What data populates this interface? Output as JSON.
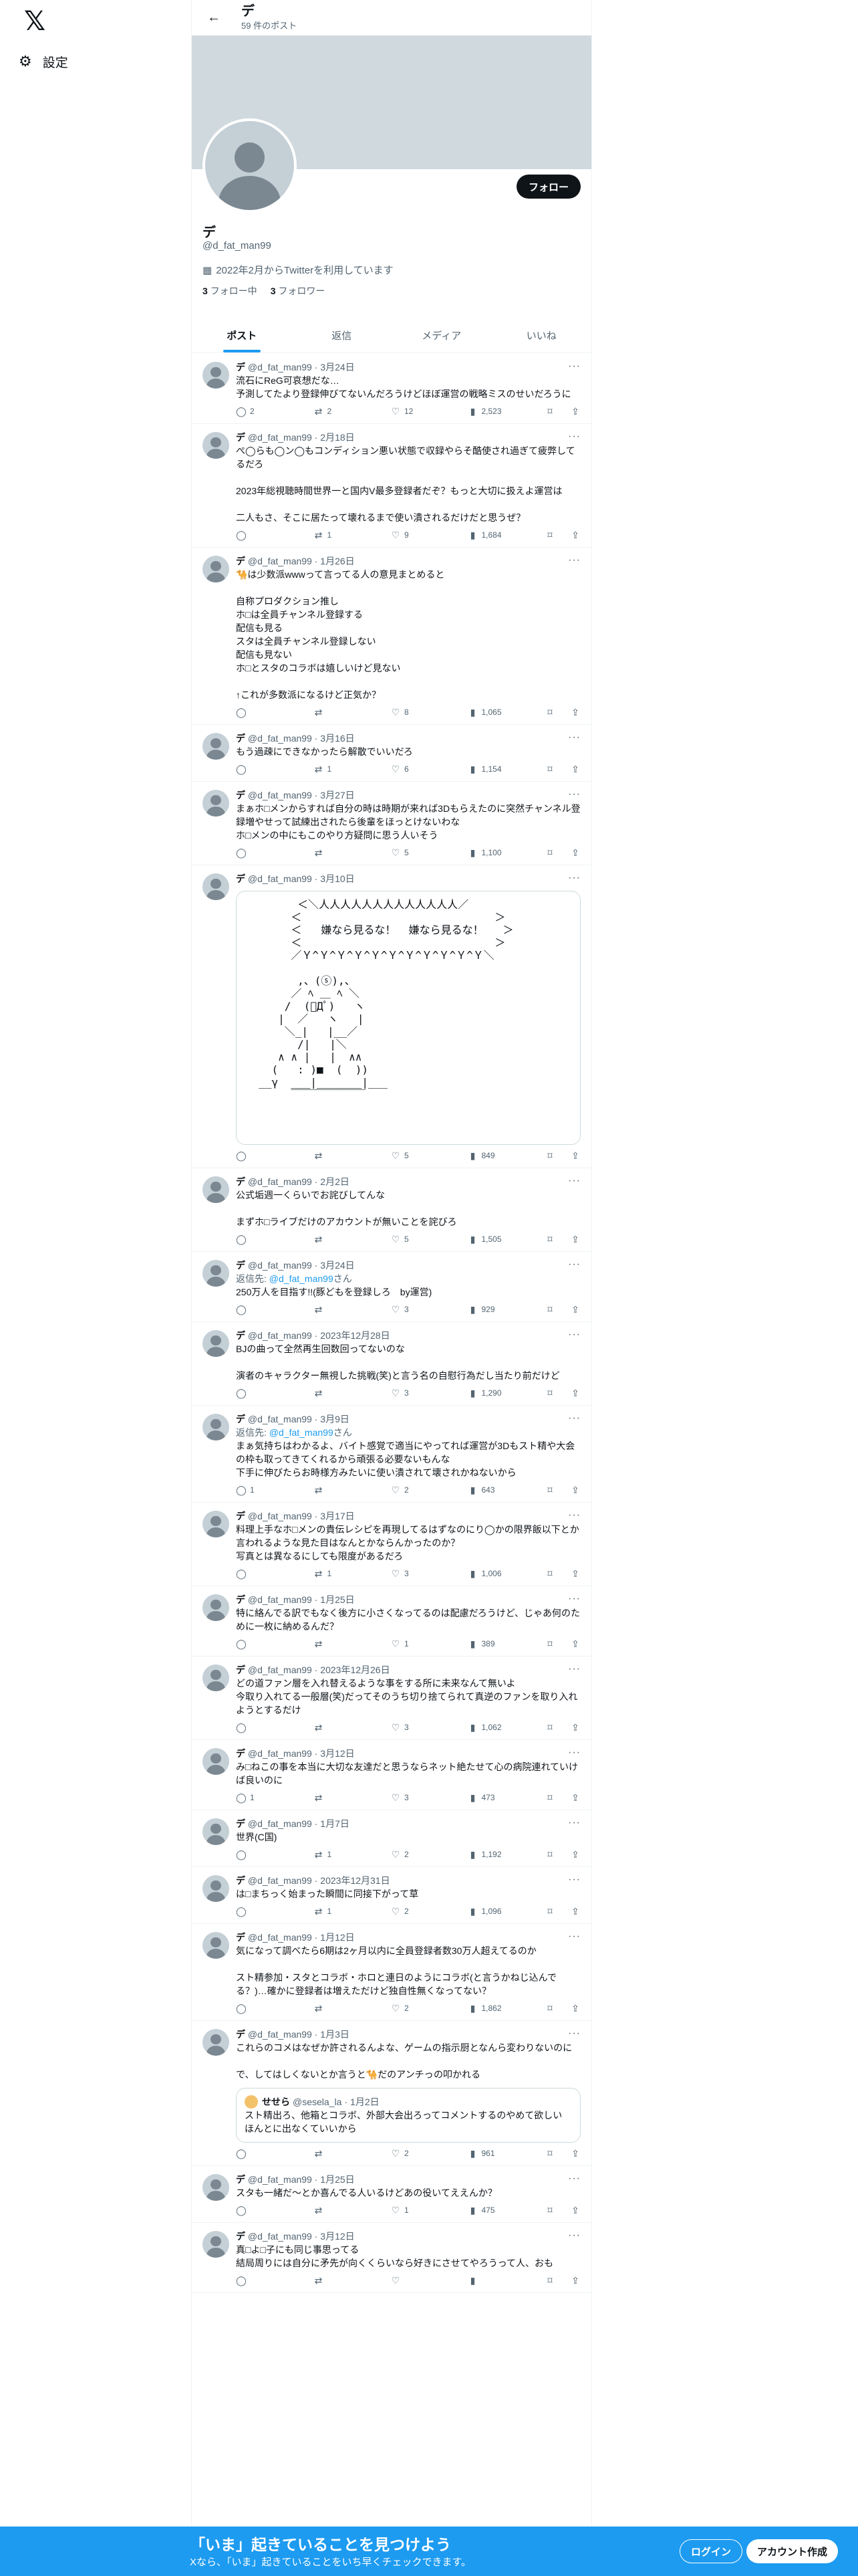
{
  "nav": {
    "logo": "𝕏",
    "settings_icon": "⚙",
    "settings_label": "設定"
  },
  "topbar": {
    "name": "デ",
    "post_count": "59 件のポスト",
    "back_icon": "←"
  },
  "profile": {
    "follow_label": "フォロー",
    "name": "デ",
    "handle": "@d_fat_man99",
    "joined": "2022年2月からTwitterを利用しています",
    "following_count": "3",
    "following_label": "フォロー中",
    "followers_count": "3",
    "followers_label": "フォロワー"
  },
  "tabs": [
    "ポスト",
    "返信",
    "メディア",
    "いいね"
  ],
  "tweets": [
    {
      "name": "デ",
      "handle": "@d_fat_man99",
      "date": "3月24日",
      "text": "流石にReG可哀想だな…\n予測してたより登録伸びてないんだろうけどほぼ運営の戦略ミスのせいだろうに",
      "reply": "2",
      "rt": "2",
      "like": "12",
      "views": "2,523"
    },
    {
      "name": "デ",
      "handle": "@d_fat_man99",
      "date": "2月18日",
      "text": "ぺ◯らも◯ン◯もコンディション悪い状態で収録やらそ酷使され過ぎて疲弊してるだろ\n\n2023年総視聴時間世界一と国内V最多登録者だぞ？もっと大切に扱えよ運営は\n\n二人もさ、そこに居たって壊れるまで使い潰されるだけだと思うぜ？",
      "reply": "",
      "rt": "1",
      "like": "9",
      "views": "1,684"
    },
    {
      "name": "デ",
      "handle": "@d_fat_man99",
      "date": "1月26日",
      "text": "🐪は少数派wwwって言ってる人の意見まとめると\n\n自称プロダクション推し\nホ□は全員チャンネル登録する\n配信も見る\nスタは全員チャンネル登録しない\n配信も見ない\nホ□とスタのコラボは嬉しいけど見ない\n\n↑これが多数派になるけど正気か？",
      "reply": "",
      "rt": "",
      "like": "8",
      "views": "1,065"
    },
    {
      "name": "デ",
      "handle": "@d_fat_man99",
      "date": "3月16日",
      "text": "もう過疎にできなかったら解散でいいだろ",
      "reply": "",
      "rt": "1",
      "like": "6",
      "views": "1,154"
    },
    {
      "name": "デ",
      "handle": "@d_fat_man99",
      "date": "3月27日",
      "text": "まぁホ□メンからすれば自分の時は時期が来れば3Dもらえたのに突然チャンネル登録増やせって試練出されたら後輩をほっとけないわな\nホ□メンの中にもこのやり方疑問に思う人いそう",
      "reply": "",
      "rt": "",
      "like": "5",
      "views": "1,100"
    },
    {
      "name": "デ",
      "handle": "@d_fat_man99",
      "date": "3月10日",
      "text": "",
      "reply": "",
      "rt": "",
      "like": "5",
      "views": "849",
      "has_aa": true
    },
    {
      "name": "デ",
      "handle": "@d_fat_man99",
      "date": "2月2日",
      "text": "公式垢週一くらいでお詫びしてんな\n\nまずホ□ライブだけのアカウントが無いことを詫びろ",
      "reply": "",
      "rt": "",
      "like": "5",
      "views": "1,505"
    },
    {
      "name": "デ",
      "handle": "@d_fat_man99",
      "date": "3月24日",
      "reply_to": "@d_fat_man99",
      "text": "250万人を目指す!!(豚どもを登録しろ　by運営)",
      "reply": "",
      "rt": "",
      "like": "3",
      "views": "929"
    },
    {
      "name": "デ",
      "handle": "@d_fat_man99",
      "date": "2023年12月28日",
      "text": "BJの曲って全然再生回数回ってないのな\n\n演者のキャラクター無視した挑戦(笑)と言う名の自慰行為だし当たり前だけど",
      "reply": "",
      "rt": "",
      "like": "3",
      "views": "1,290"
    },
    {
      "name": "デ",
      "handle": "@d_fat_man99",
      "date": "3月9日",
      "reply_to": "@d_fat_man99",
      "text": "まぁ気持ちはわかるよ、バイト感覚で適当にやってれば運営が3Dもスト精や大会の枠も取ってきてくれるから頑張る必要ないもんな\n下手に伸びたらお時様方みたいに使い潰されて壊されかねないから",
      "reply": "1",
      "rt": "",
      "like": "2",
      "views": "643"
    },
    {
      "name": "デ",
      "handle": "@d_fat_man99",
      "date": "3月17日",
      "text": "料理上手なホ□メンの貴伝レシピを再現してるはずなのにり◯かの限界飯以下とか言われるような見た目はなんとかならんかったのか？\n写真とは異なるにしても限度があるだろ",
      "reply": "",
      "rt": "1",
      "like": "3",
      "views": "1,006"
    },
    {
      "name": "デ",
      "handle": "@d_fat_man99",
      "date": "1月25日",
      "text": "特に絡んでる訳でもなく後方に小さくなってるのは配慮だろうけど、じゃあ何のために一枚に納めるんだ？",
      "reply": "",
      "rt": "",
      "like": "1",
      "views": "389"
    },
    {
      "name": "デ",
      "handle": "@d_fat_man99",
      "date": "2023年12月26日",
      "text": "どの道ファン層を入れ替えるような事をする所に未来なんて無いよ\n今取り入れてる一般層(笑)だってそのうち切り捨てられて真逆のファンを取り入れようとするだけ",
      "reply": "",
      "rt": "",
      "like": "3",
      "views": "1,062"
    },
    {
      "name": "デ",
      "handle": "@d_fat_man99",
      "date": "3月12日",
      "text": "み□ねこの事を本当に大切な友達だと思うならネット絶たせて心の病院連れていけば良いのに",
      "reply": "1",
      "rt": "",
      "like": "3",
      "views": "473"
    },
    {
      "name": "デ",
      "handle": "@d_fat_man99",
      "date": "1月7日",
      "text": "世界(C国)",
      "reply": "",
      "rt": "1",
      "like": "2",
      "views": "1,192"
    },
    {
      "name": "デ",
      "handle": "@d_fat_man99",
      "date": "2023年12月31日",
      "text": "は□まちっく始まった瞬間に同接下がって草",
      "reply": "",
      "rt": "1",
      "like": "2",
      "views": "1,096"
    },
    {
      "name": "デ",
      "handle": "@d_fat_man99",
      "date": "1月12日",
      "text": "気になって調べたら6期は2ヶ月以内に全員登録者数30万人超えてるのか\n\nスト精参加・スタとコラボ・ホロと連日のようにコラボ(と言うかねじ込んでる？)…確かに登録者は増えただけど独自性無くなってない？",
      "reply": "",
      "rt": "",
      "like": "2",
      "views": "1,862"
    },
    {
      "name": "デ",
      "handle": "@d_fat_man99",
      "date": "1月3日",
      "text": "これらのコメはなぜか許されるんよな、ゲームの指示厨となんら変わりないのに\n\nで、してはしくないとか言うと🐪だのアンチっの叩かれる",
      "reply": "",
      "rt": "",
      "like": "2",
      "views": "961",
      "quote": {
        "name": "せせら",
        "handle": "@sesela_la",
        "date": "1月2日",
        "text": "スト精出ろ、他箱とコラボ、外部大会出ろってコメントするのやめて欲しい\nほんとに出なくていいから"
      }
    },
    {
      "name": "デ",
      "handle": "@d_fat_man99",
      "date": "1月25日",
      "text": "スタも一緒だ〜とか喜んでる人いるけどあの役いてええんか？",
      "reply": "",
      "rt": "",
      "like": "1",
      "views": "475"
    },
    {
      "name": "デ",
      "handle": "@d_fat_man99",
      "date": "3月12日",
      "text": "真□よ□子にも同じ事思ってる\n結局周りには自分に矛先が向くくらいなら好きにさせてやろうって人、おも",
      "reply": "",
      "rt": "",
      "like": "",
      "views": ""
    }
  ],
  "aa_art": "        ＜＼人人人人人人人人人人人人人／\n       ＜                              ＞\n       ＜   嫌なら見るな！  嫌なら見るな！   ＞\n       ＜                              ＞\n       ／Ｙ^Ｙ^Ｙ^Ｙ^Ｙ^Ｙ^Ｙ^Ｙ^Ｙ^Ｙ^Ｙ＼\n\n        ,、(ⓢ),、\n       ／ ﾍ ＿ ﾍ ＼\n      /  (ﾟДﾟ)   ヽ\n     |  ／   ヽ   |\n      ＼_|   |__／\n        /|   |＼\n     ∧ ∧ |   |  ∧∧\n    (   : )■  (  ))\n  __γ  ___|_______|___\n       ￣￣￣￣￣￣￣",
  "bottom": {
    "title": "「いま」起きていることを見つけよう",
    "subtitle": "Xなら、「いま」起きていることをいち早くチェックできます。",
    "login": "ログイン",
    "signup": "アカウント作成"
  },
  "colors": {
    "accent": "#1d9bf0",
    "text": "#0f1419",
    "muted": "#536471",
    "banner": "#cfd9de"
  }
}
